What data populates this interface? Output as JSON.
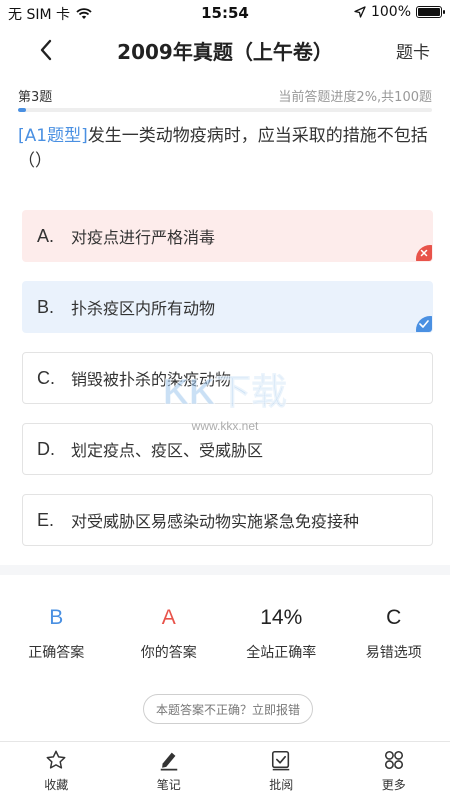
{
  "status_bar": {
    "carrier": "无 SIM 卡",
    "time": "15:54",
    "battery": "100%",
    "battery_level": 1.0
  },
  "nav": {
    "title": "2009年真题（上午卷）",
    "right_label": "题卡"
  },
  "progress": {
    "question_label": "第3题",
    "text": "当前答题进度2%,共100题",
    "fraction": 0.02
  },
  "question": {
    "type_tag": "[A1题型]",
    "text": "发生一类动物疫病时，应当采取的措施不包括（）"
  },
  "options": [
    {
      "letter": "A.",
      "text": "对疫点进行严格消毒",
      "state": "wrong"
    },
    {
      "letter": "B.",
      "text": "扑杀疫区内所有动物",
      "state": "correct"
    },
    {
      "letter": "C.",
      "text": "销毁被扑杀的染疫动物",
      "state": "none"
    },
    {
      "letter": "D.",
      "text": "划定疫点、疫区、受威胁区",
      "state": "none"
    },
    {
      "letter": "E.",
      "text": "对受威胁区易感染动物实施紧急免疫接种",
      "state": "none"
    }
  ],
  "watermark": {
    "brand": "KK下载",
    "url": "www.kkx.net"
  },
  "stats": [
    {
      "value": "B",
      "label": "正确答案",
      "color": "#4a90e2"
    },
    {
      "value": "A",
      "label": "你的答案",
      "color": "#e8534a"
    },
    {
      "value": "14%",
      "label": "全站正确率",
      "color": "#222222"
    },
    {
      "value": "C",
      "label": "易错选项",
      "color": "#222222"
    }
  ],
  "report_button": "本题答案不正确？立即报错",
  "tabs": [
    {
      "label": "收藏",
      "icon": "star-icon"
    },
    {
      "label": "笔记",
      "icon": "pen-icon"
    },
    {
      "label": "批阅",
      "icon": "check-box-icon"
    },
    {
      "label": "更多",
      "icon": "grid-icon"
    }
  ],
  "colors": {
    "accent": "#4a90e2",
    "wrong": "#e8534a",
    "wrong_bg": "#fdeceb",
    "correct_bg": "#eaf2fc"
  }
}
